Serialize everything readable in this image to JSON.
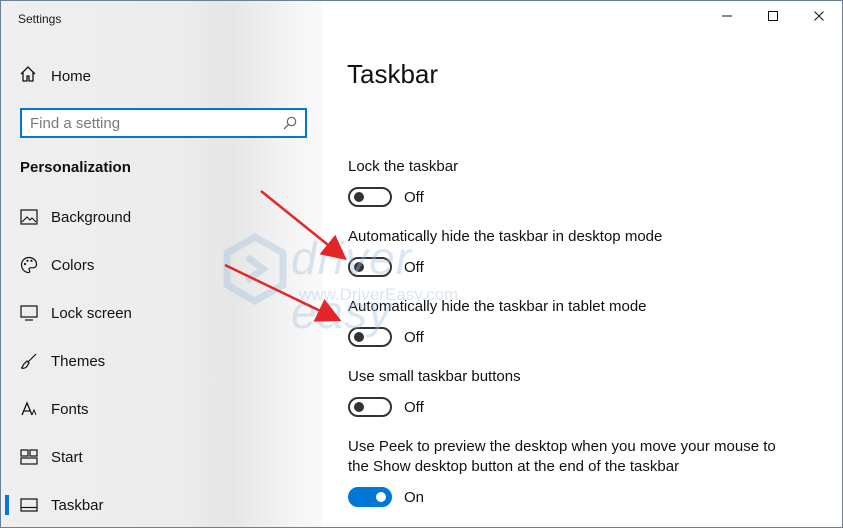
{
  "window": {
    "title": "Settings"
  },
  "sidebar": {
    "home_label": "Home",
    "search_placeholder": "Find a setting",
    "section_title": "Personalization",
    "items": [
      {
        "label": "Background",
        "icon": "picture-icon"
      },
      {
        "label": "Colors",
        "icon": "palette-icon"
      },
      {
        "label": "Lock screen",
        "icon": "monitor-icon"
      },
      {
        "label": "Themes",
        "icon": "brush-icon"
      },
      {
        "label": "Fonts",
        "icon": "font-icon"
      },
      {
        "label": "Start",
        "icon": "start-icon"
      },
      {
        "label": "Taskbar",
        "icon": "taskbar-icon",
        "active": true
      }
    ]
  },
  "main": {
    "title": "Taskbar",
    "settings": [
      {
        "label": "Lock the taskbar",
        "state": "Off",
        "on": false
      },
      {
        "label": "Automatically hide the taskbar in desktop mode",
        "state": "Off",
        "on": false
      },
      {
        "label": "Automatically hide the taskbar in tablet mode",
        "state": "Off",
        "on": false
      },
      {
        "label": "Use small taskbar buttons",
        "state": "Off",
        "on": false
      },
      {
        "label": "Use Peek to preview the desktop when you move your mouse to the Show desktop button at the end of the taskbar",
        "state": "On",
        "on": true
      }
    ]
  },
  "watermark": {
    "text": "driver easy",
    "url": "www.DriverEasy.com"
  },
  "colors": {
    "accent": "#0078d7",
    "arrow": "#e3262a",
    "sidebar_bg": "#ececec"
  }
}
